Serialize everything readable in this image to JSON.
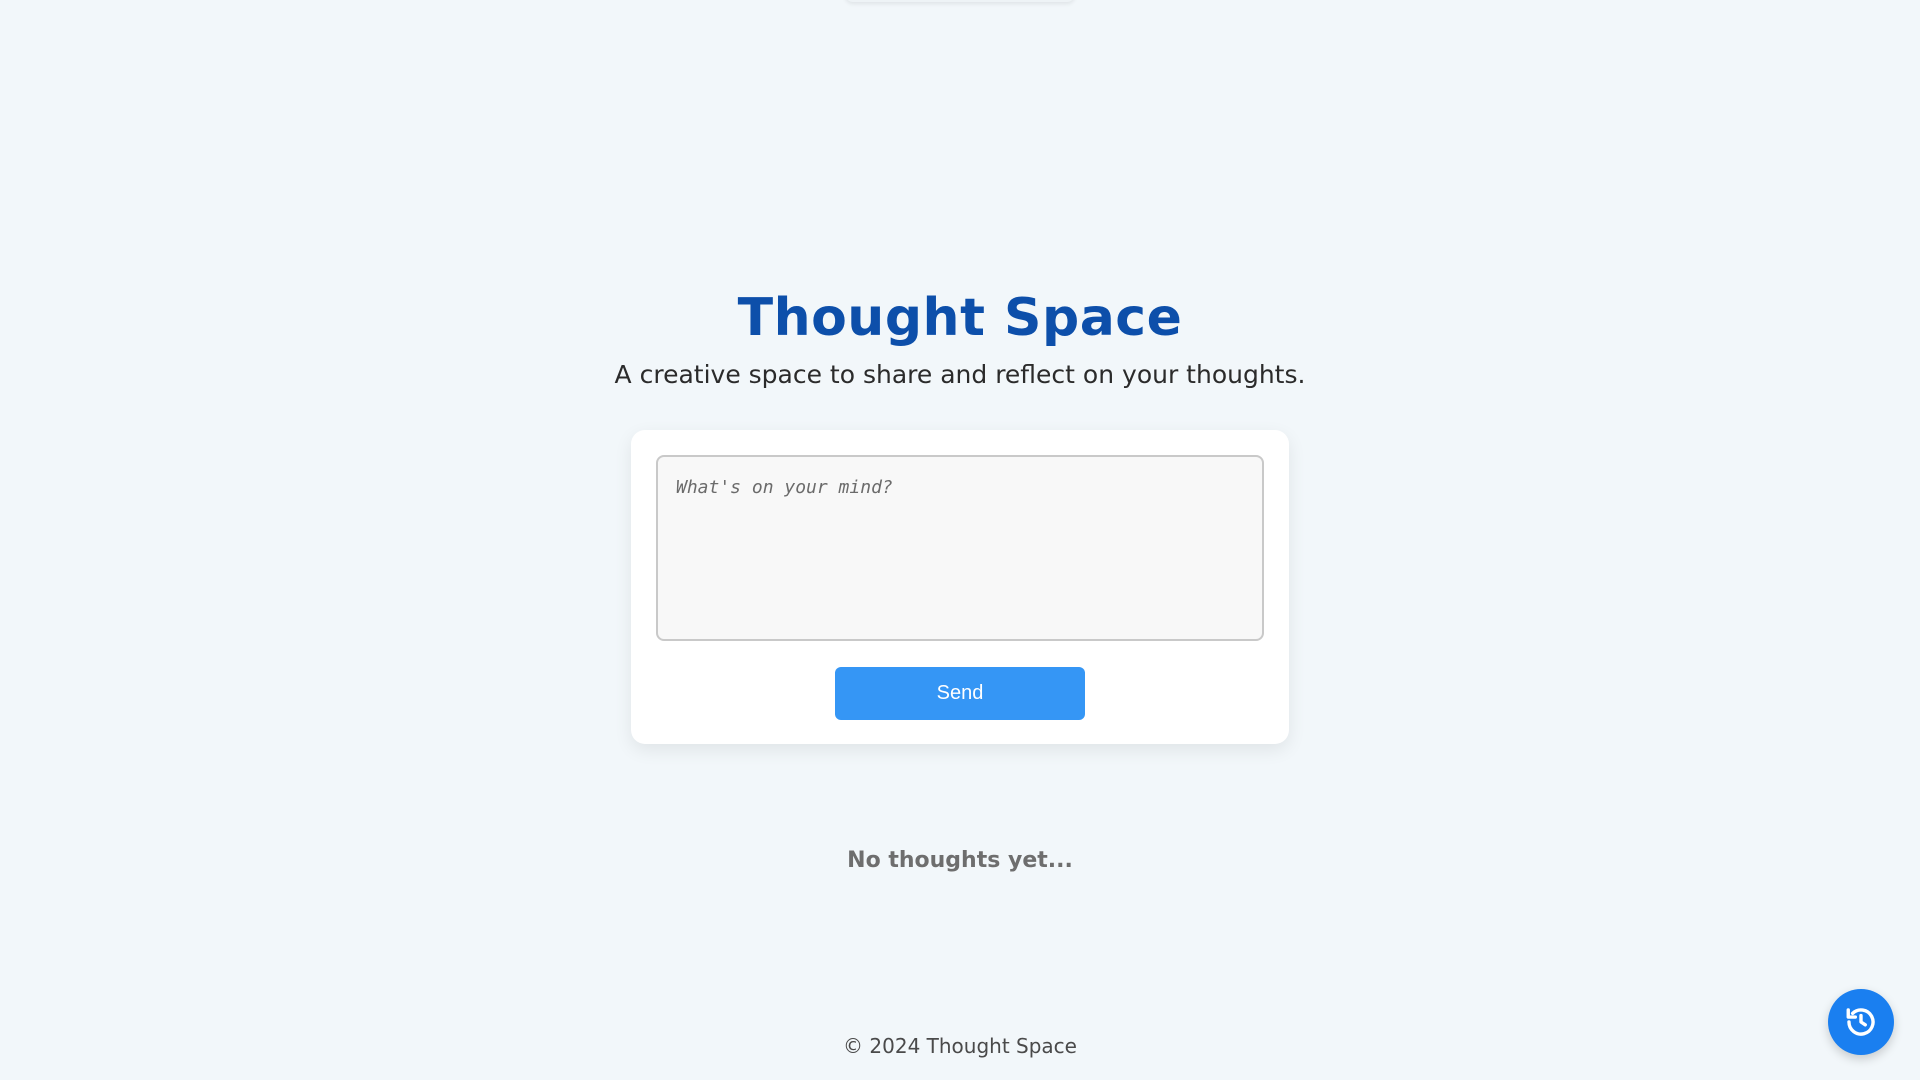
{
  "app": {
    "title": "Thought Space",
    "subtitle": "A creative space to share and reflect on your thoughts."
  },
  "composer": {
    "placeholder": "What's on your mind?",
    "value": "",
    "send_label": "Send"
  },
  "thoughts": {
    "empty_message": "No thoughts yet..."
  },
  "footer": {
    "text": "© 2024 Thought Space"
  },
  "fab": {
    "icon": "history-icon"
  },
  "colors": {
    "background": "#f2f7fa",
    "title": "#0d4faa",
    "send_button": "#3596f5",
    "history_button": "#1a7ff0"
  }
}
